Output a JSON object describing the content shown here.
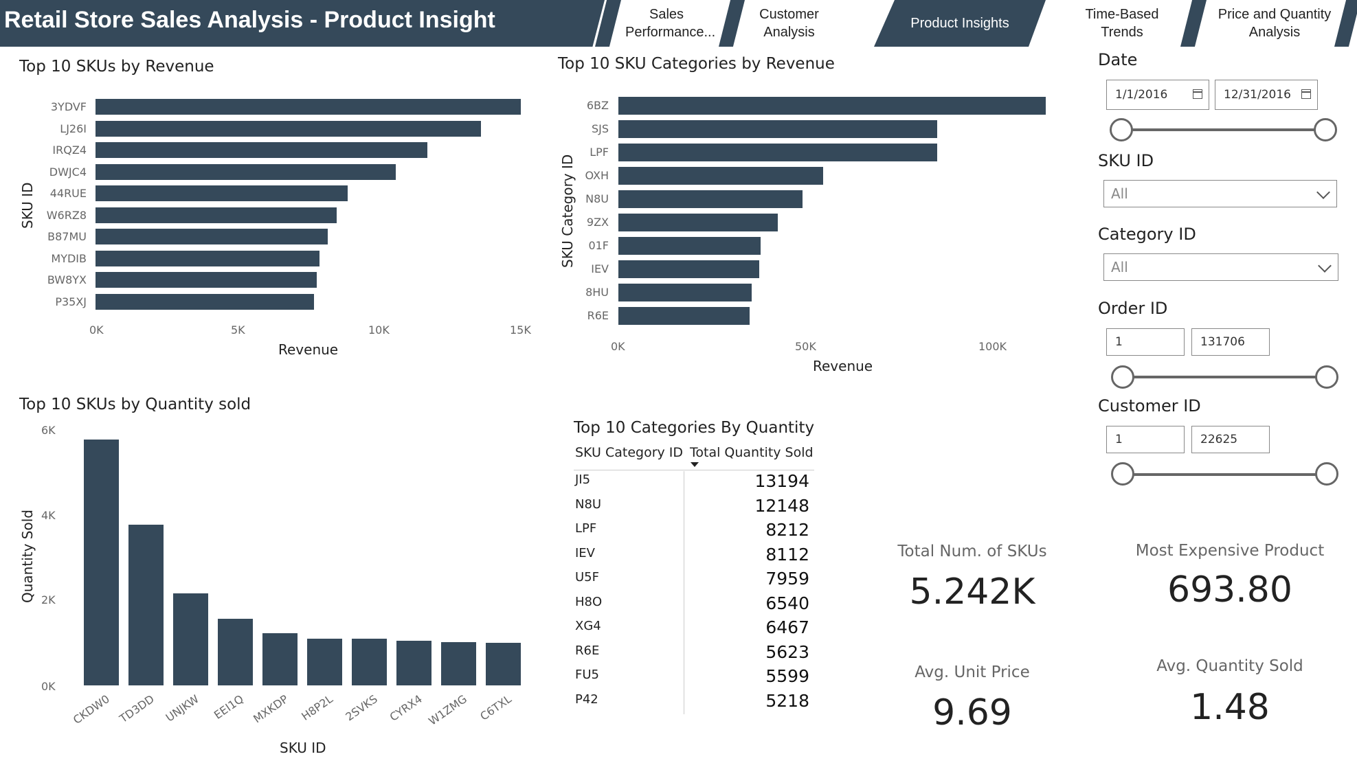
{
  "header": {
    "title": "Retail Store Sales Analysis - Product Insight",
    "tabs": [
      {
        "label": "Sales Performance...",
        "active": false
      },
      {
        "label": "Customer Analysis",
        "active": false
      },
      {
        "label": "Product Insights",
        "active": true
      },
      {
        "label": "Time-Based Trends",
        "active": false
      },
      {
        "label": "Price and Quantity Analysis",
        "active": false
      }
    ]
  },
  "colors": {
    "accent": "#35495a",
    "background": "#ffffff"
  },
  "charts": {
    "top_skus_revenue": {
      "title": "Top 10 SKUs by Revenue",
      "xlabel": "Revenue",
      "ylabel": "SKU ID",
      "ticks": [
        "0K",
        "5K",
        "10K",
        "15K"
      ]
    },
    "top_categories_revenue": {
      "title": "Top 10 SKU Categories by Revenue",
      "xlabel": "Revenue",
      "ylabel": "SKU Category ID",
      "ticks": [
        "0K",
        "50K",
        "100K"
      ]
    },
    "top_skus_quantity": {
      "title": "Top 10 SKUs by Quantity sold",
      "xlabel": "SKU ID",
      "ylabel": "Quantity Sold",
      "ticks": [
        "0K",
        "2K",
        "4K",
        "6K"
      ]
    }
  },
  "chart_data": [
    {
      "type": "bar",
      "orientation": "horizontal",
      "title": "Top 10 SKUs by Revenue",
      "xlabel": "Revenue",
      "ylabel": "SKU ID",
      "categories": [
        "3YDVF",
        "LJ26I",
        "IRQZ4",
        "DWJC4",
        "44RUE",
        "W6RZ8",
        "B87MU",
        "MYDIB",
        "BW8YX",
        "P35XJ"
      ],
      "values": [
        15000,
        13600,
        11700,
        10600,
        8900,
        8500,
        8200,
        7900,
        7800,
        7700
      ],
      "xlim": [
        0,
        15000
      ]
    },
    {
      "type": "bar",
      "orientation": "horizontal",
      "title": "Top 10 SKU Categories by Revenue",
      "xlabel": "Revenue",
      "ylabel": "SKU Category ID",
      "categories": [
        "6BZ",
        "SJS",
        "LPF",
        "OXH",
        "N8U",
        "9ZX",
        "01F",
        "IEV",
        "8HU",
        "R6E"
      ],
      "values": [
        114000,
        85000,
        85000,
        54500,
        49000,
        42500,
        38000,
        37500,
        35500,
        35000
      ],
      "xlim": [
        0,
        100000
      ]
    },
    {
      "type": "bar",
      "orientation": "vertical",
      "title": "Top 10 SKUs by Quantity sold",
      "xlabel": "SKU ID",
      "ylabel": "Quantity Sold",
      "categories": [
        "CKDW0",
        "TD3DD",
        "UNJKW",
        "EEI1Q",
        "MXKDP",
        "H8P2L",
        "2SVKS",
        "CYRX4",
        "W1ZMG",
        "C6TXL"
      ],
      "values": [
        5800,
        3800,
        2180,
        1570,
        1240,
        1110,
        1100,
        1050,
        1020,
        1010
      ],
      "ylim": [
        0,
        6000
      ]
    },
    {
      "type": "table",
      "title": "Top 10 Categories By Quantity",
      "columns": [
        "SKU Category ID",
        "Total Quantity Sold"
      ],
      "rows": [
        [
          "JI5",
          13194
        ],
        [
          "N8U",
          12148
        ],
        [
          "LPF",
          8212
        ],
        [
          "IEV",
          8112
        ],
        [
          "U5F",
          7959
        ],
        [
          "H8O",
          6540
        ],
        [
          "XG4",
          6467
        ],
        [
          "R6E",
          5623
        ],
        [
          "FU5",
          5599
        ],
        [
          "P42",
          5218
        ]
      ]
    }
  ],
  "table": {
    "title": "Top 10 Categories By Quantity",
    "col1": "SKU Category ID",
    "col2": "Total Quantity Sold",
    "rows": [
      {
        "id": "JI5",
        "qty": "13194"
      },
      {
        "id": "N8U",
        "qty": "12148"
      },
      {
        "id": "LPF",
        "qty": "8212"
      },
      {
        "id": "IEV",
        "qty": "8112"
      },
      {
        "id": "U5F",
        "qty": "7959"
      },
      {
        "id": "H8O",
        "qty": "6540"
      },
      {
        "id": "XG4",
        "qty": "6467"
      },
      {
        "id": "R6E",
        "qty": "5623"
      },
      {
        "id": "FU5",
        "qty": "5599"
      },
      {
        "id": "P42",
        "qty": "5218"
      }
    ]
  },
  "kpis": {
    "total_skus": {
      "label": "Total Num. of SKUs",
      "value": "5.242K"
    },
    "most_expensive": {
      "label": "Most Expensive Product",
      "value": "693.80"
    },
    "avg_unit_price": {
      "label": "Avg. Unit Price",
      "value": "9.69"
    },
    "avg_quantity": {
      "label": "Avg. Quantity Sold",
      "value": "1.48"
    }
  },
  "slicers": {
    "date": {
      "title": "Date",
      "start": "1/1/2016",
      "end": "12/31/2016",
      "start_icon": "calendar-icon",
      "end_icon": "calendar-icon"
    },
    "sku_id": {
      "title": "SKU ID",
      "value": "All",
      "icon": "chevron-down-icon"
    },
    "category_id": {
      "title": "Category ID",
      "value": "All",
      "icon": "chevron-down-icon"
    },
    "order_id": {
      "title": "Order ID",
      "min": "1",
      "max": "131706"
    },
    "customer_id": {
      "title": "Customer ID",
      "min": "1",
      "max": "22625"
    }
  }
}
